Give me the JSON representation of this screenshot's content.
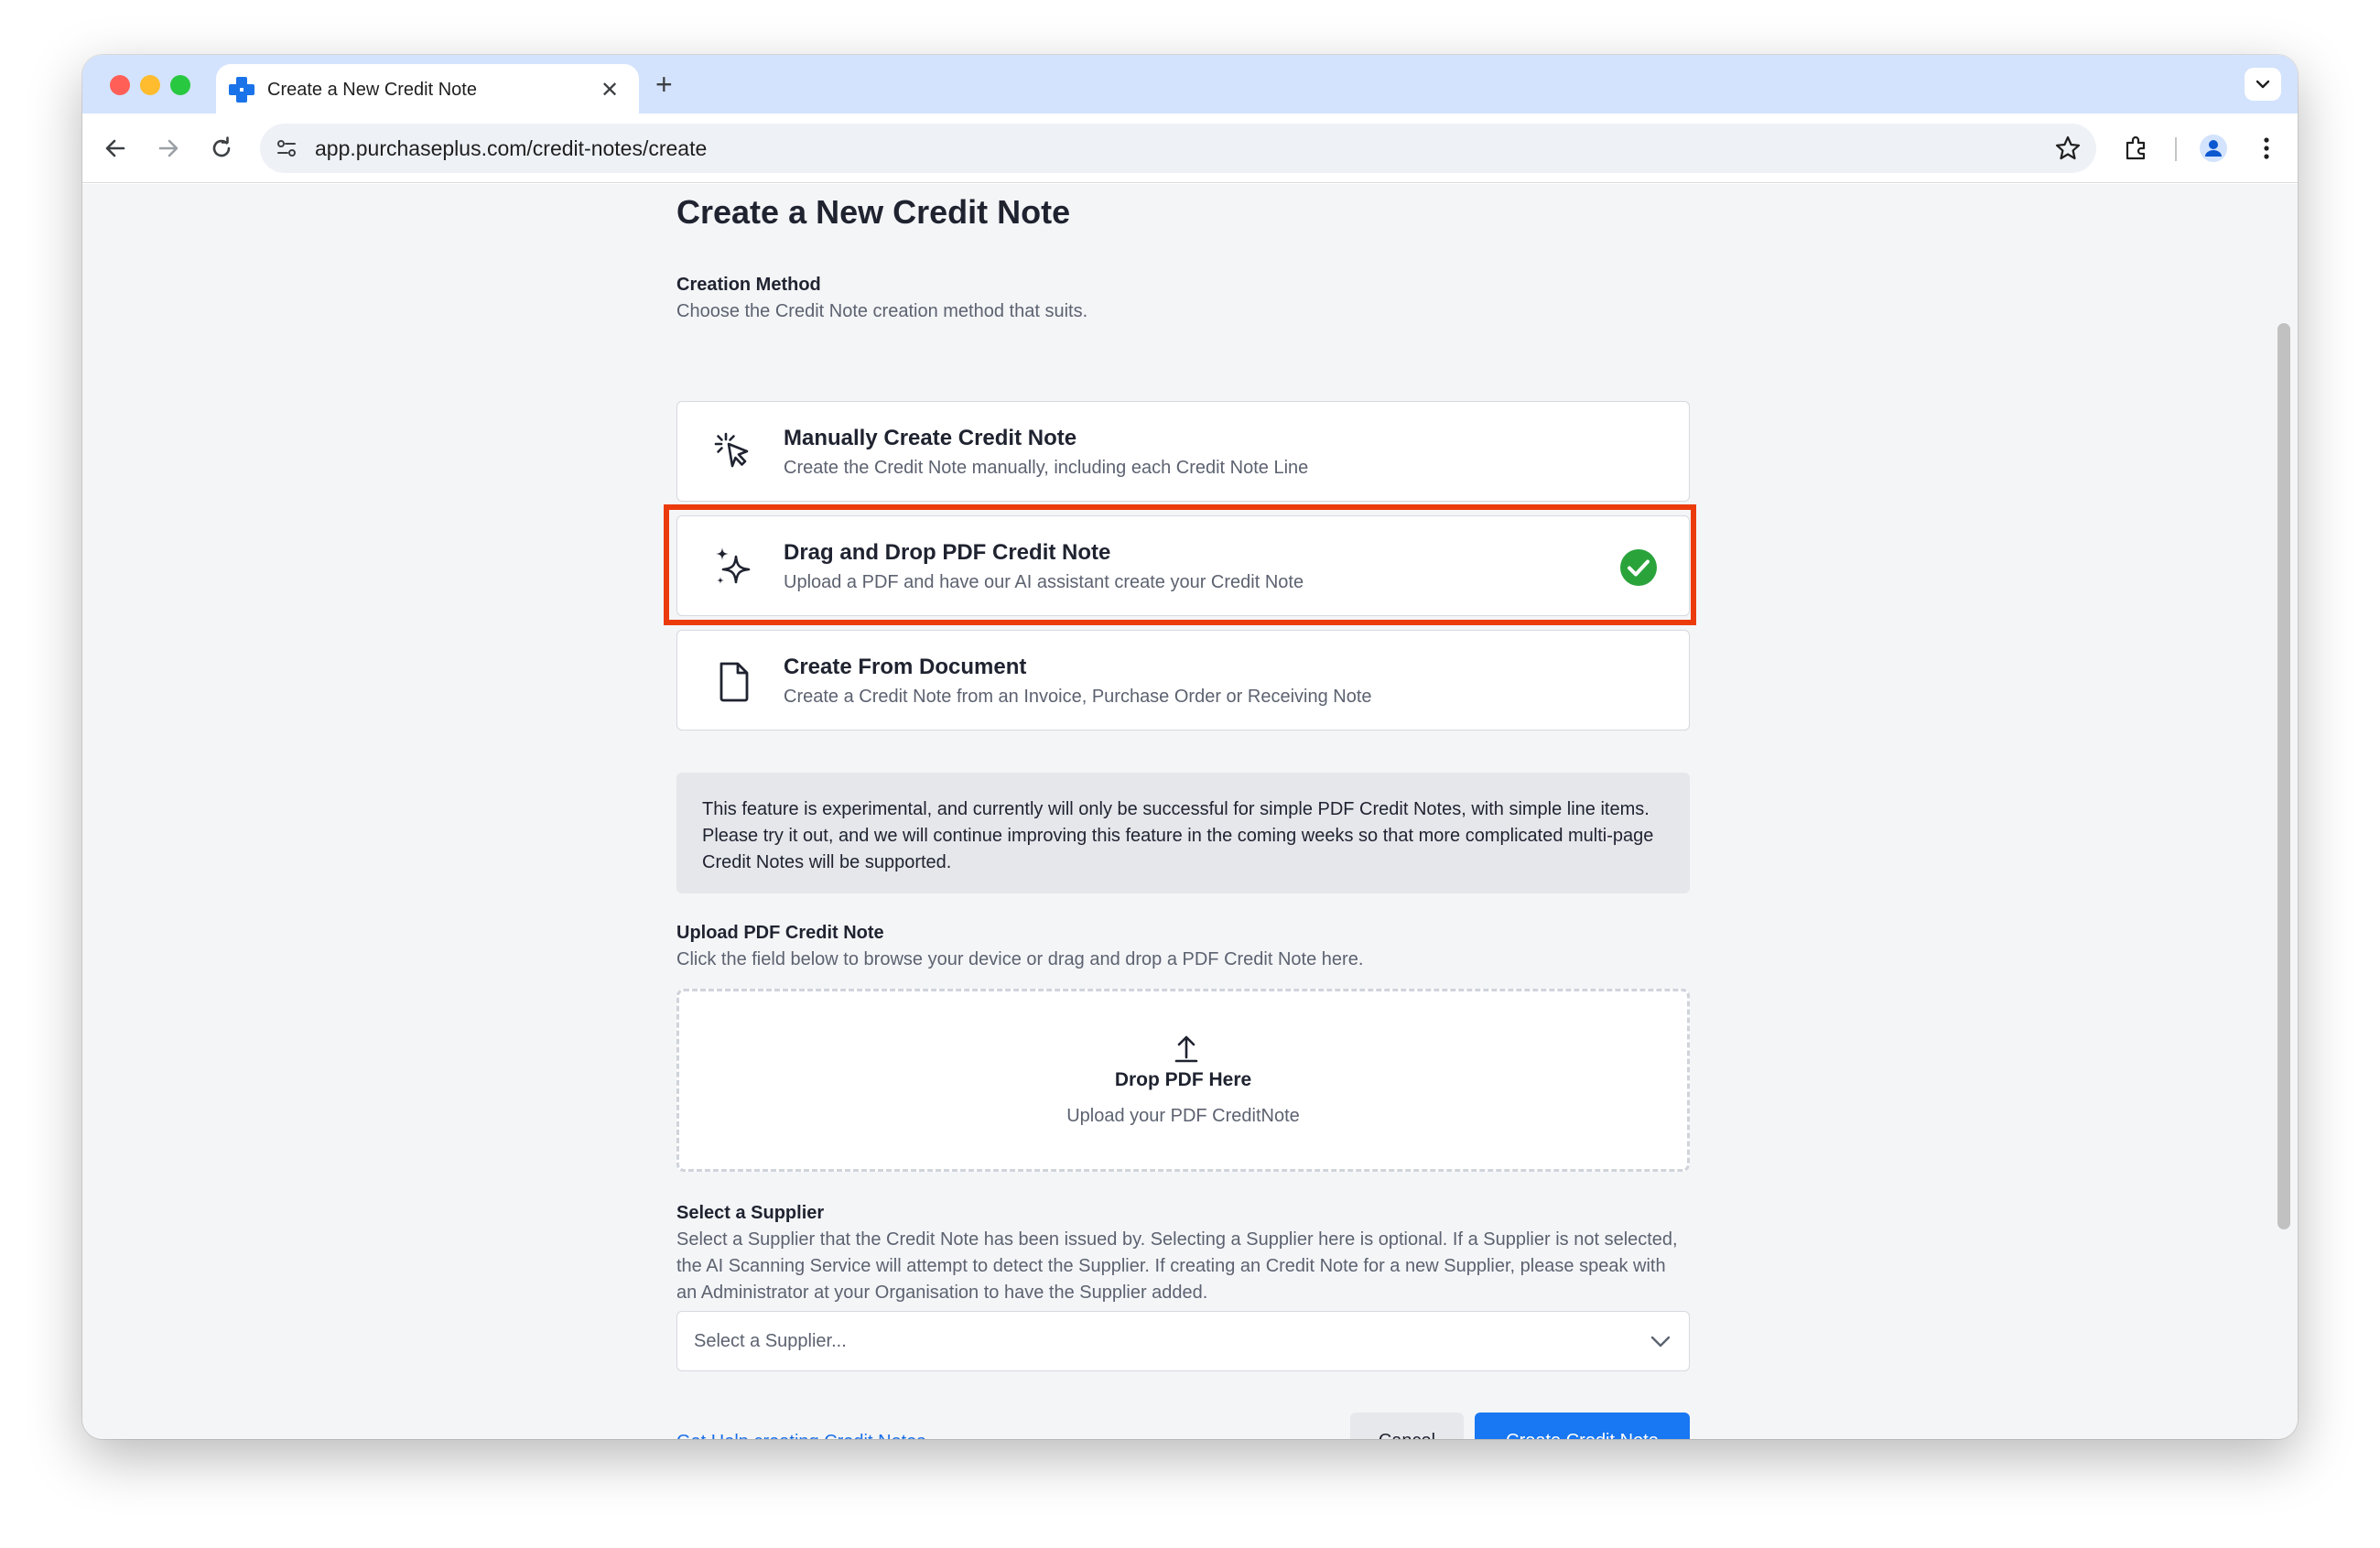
{
  "browser": {
    "tab_title": "Create a New Credit Note",
    "new_tab_symbol": "+",
    "close_symbol": "✕",
    "url": "app.purchaseplus.com/credit-notes/create"
  },
  "page": {
    "title": "Create a New Credit Note",
    "creation_method": {
      "label": "Creation Method",
      "help": "Choose the Credit Note creation method that suits.",
      "options": [
        {
          "title": "Manually Create Credit Note",
          "description": "Create the Credit Note manually, including each Credit Note Line",
          "icon": "cursor-click-icon",
          "selected": false
        },
        {
          "title": "Drag and Drop PDF Credit Note",
          "description": "Upload a PDF and have our AI assistant create your Credit Note",
          "icon": "sparkles-icon",
          "selected": true
        },
        {
          "title": "Create From Document",
          "description": "Create a Credit Note from an Invoice, Purchase Order or Receiving Note",
          "icon": "document-icon",
          "selected": false
        }
      ]
    },
    "notice": "This feature is experimental, and currently will only be successful for simple PDF Credit Notes, with simple line items. Please try it out, and we will continue improving this feature in the coming weeks so that more complicated multi-page Credit Notes will be supported.",
    "upload": {
      "label": "Upload PDF Credit Note",
      "help": "Click the field below to browse your device or drag and drop a PDF Credit Note here.",
      "drop_title": "Drop PDF Here",
      "drop_subtitle": "Upload your PDF CreditNote"
    },
    "supplier": {
      "label": "Select a Supplier",
      "help": "Select a Supplier that the Credit Note has been issued by. Selecting a Supplier here is optional. If a Supplier is not selected, the AI Scanning Service will attempt to detect the Supplier. If creating an Credit Note for a new Supplier, please speak with an Administrator at your Organisation to have the Supplier added.",
      "placeholder": "Select a Supplier..."
    },
    "footer": {
      "help_link": "Get Help creating Credit Notes",
      "cancel": "Cancel",
      "create": "Create Credit Note"
    }
  },
  "colors": {
    "primary": "#1877f2",
    "highlight": "#ec3b0b",
    "success": "#2aa33b",
    "tabstrip": "#d3e3fd"
  }
}
